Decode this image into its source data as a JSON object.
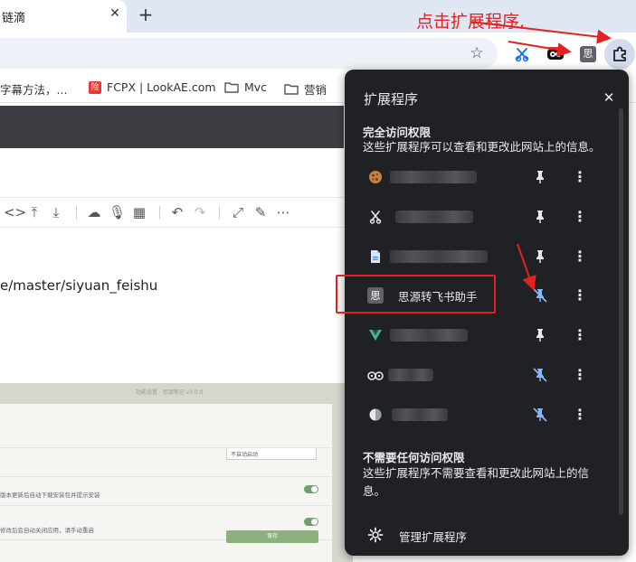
{
  "browser": {
    "tab_title": "链滴",
    "tab_close": "✕",
    "new_tab": "+"
  },
  "bookmarks": [
    {
      "label": "字幕方法，..."
    },
    {
      "label": "FCPX | LookAE.com"
    },
    {
      "label": "Mvc"
    },
    {
      "label": "营销"
    }
  ],
  "page": {
    "url_fragment": "e/master/siyuan_feishu",
    "embedded": {
      "title": "功能设置 · 思源笔记 v3.0.0",
      "select_value": "不自动启动",
      "row1": "版本更新后自动下载安装包并提示安装",
      "row2": "修改后会自动关闭应用，请手动重启",
      "button": "保存"
    }
  },
  "annotation": {
    "text": "点击扩展程序,"
  },
  "extensions_popup": {
    "title": "扩展程序",
    "close": "✕",
    "full_access": {
      "title": "完全访问权限",
      "desc": "这些扩展程序可以查看和更改此网站上的信息。"
    },
    "no_access": {
      "title": "不需要任何访问权限",
      "desc": "这些扩展程序不需要查看和更改此网站上的信息。"
    },
    "items": [
      {
        "name": "",
        "icon": "cookie-icon",
        "pinned": true
      },
      {
        "name": "",
        "icon": "scissors-icon",
        "pinned": true
      },
      {
        "name": "",
        "icon": "doc-icon",
        "pinned": true
      },
      {
        "name": "思源转飞书助手",
        "icon": "si-icon",
        "pinned": false
      },
      {
        "name": "",
        "icon": "vue-icon",
        "pinned": true
      },
      {
        "name": "",
        "icon": "owl-icon",
        "pinned": false
      },
      {
        "name": "",
        "icon": "globe-icon",
        "pinned": false
      }
    ],
    "manage_label": "管理扩展程序"
  },
  "colors": {
    "popup_bg": "#202124",
    "accent_blue": "#8ab4f8",
    "annotation_red": "#e42121"
  }
}
